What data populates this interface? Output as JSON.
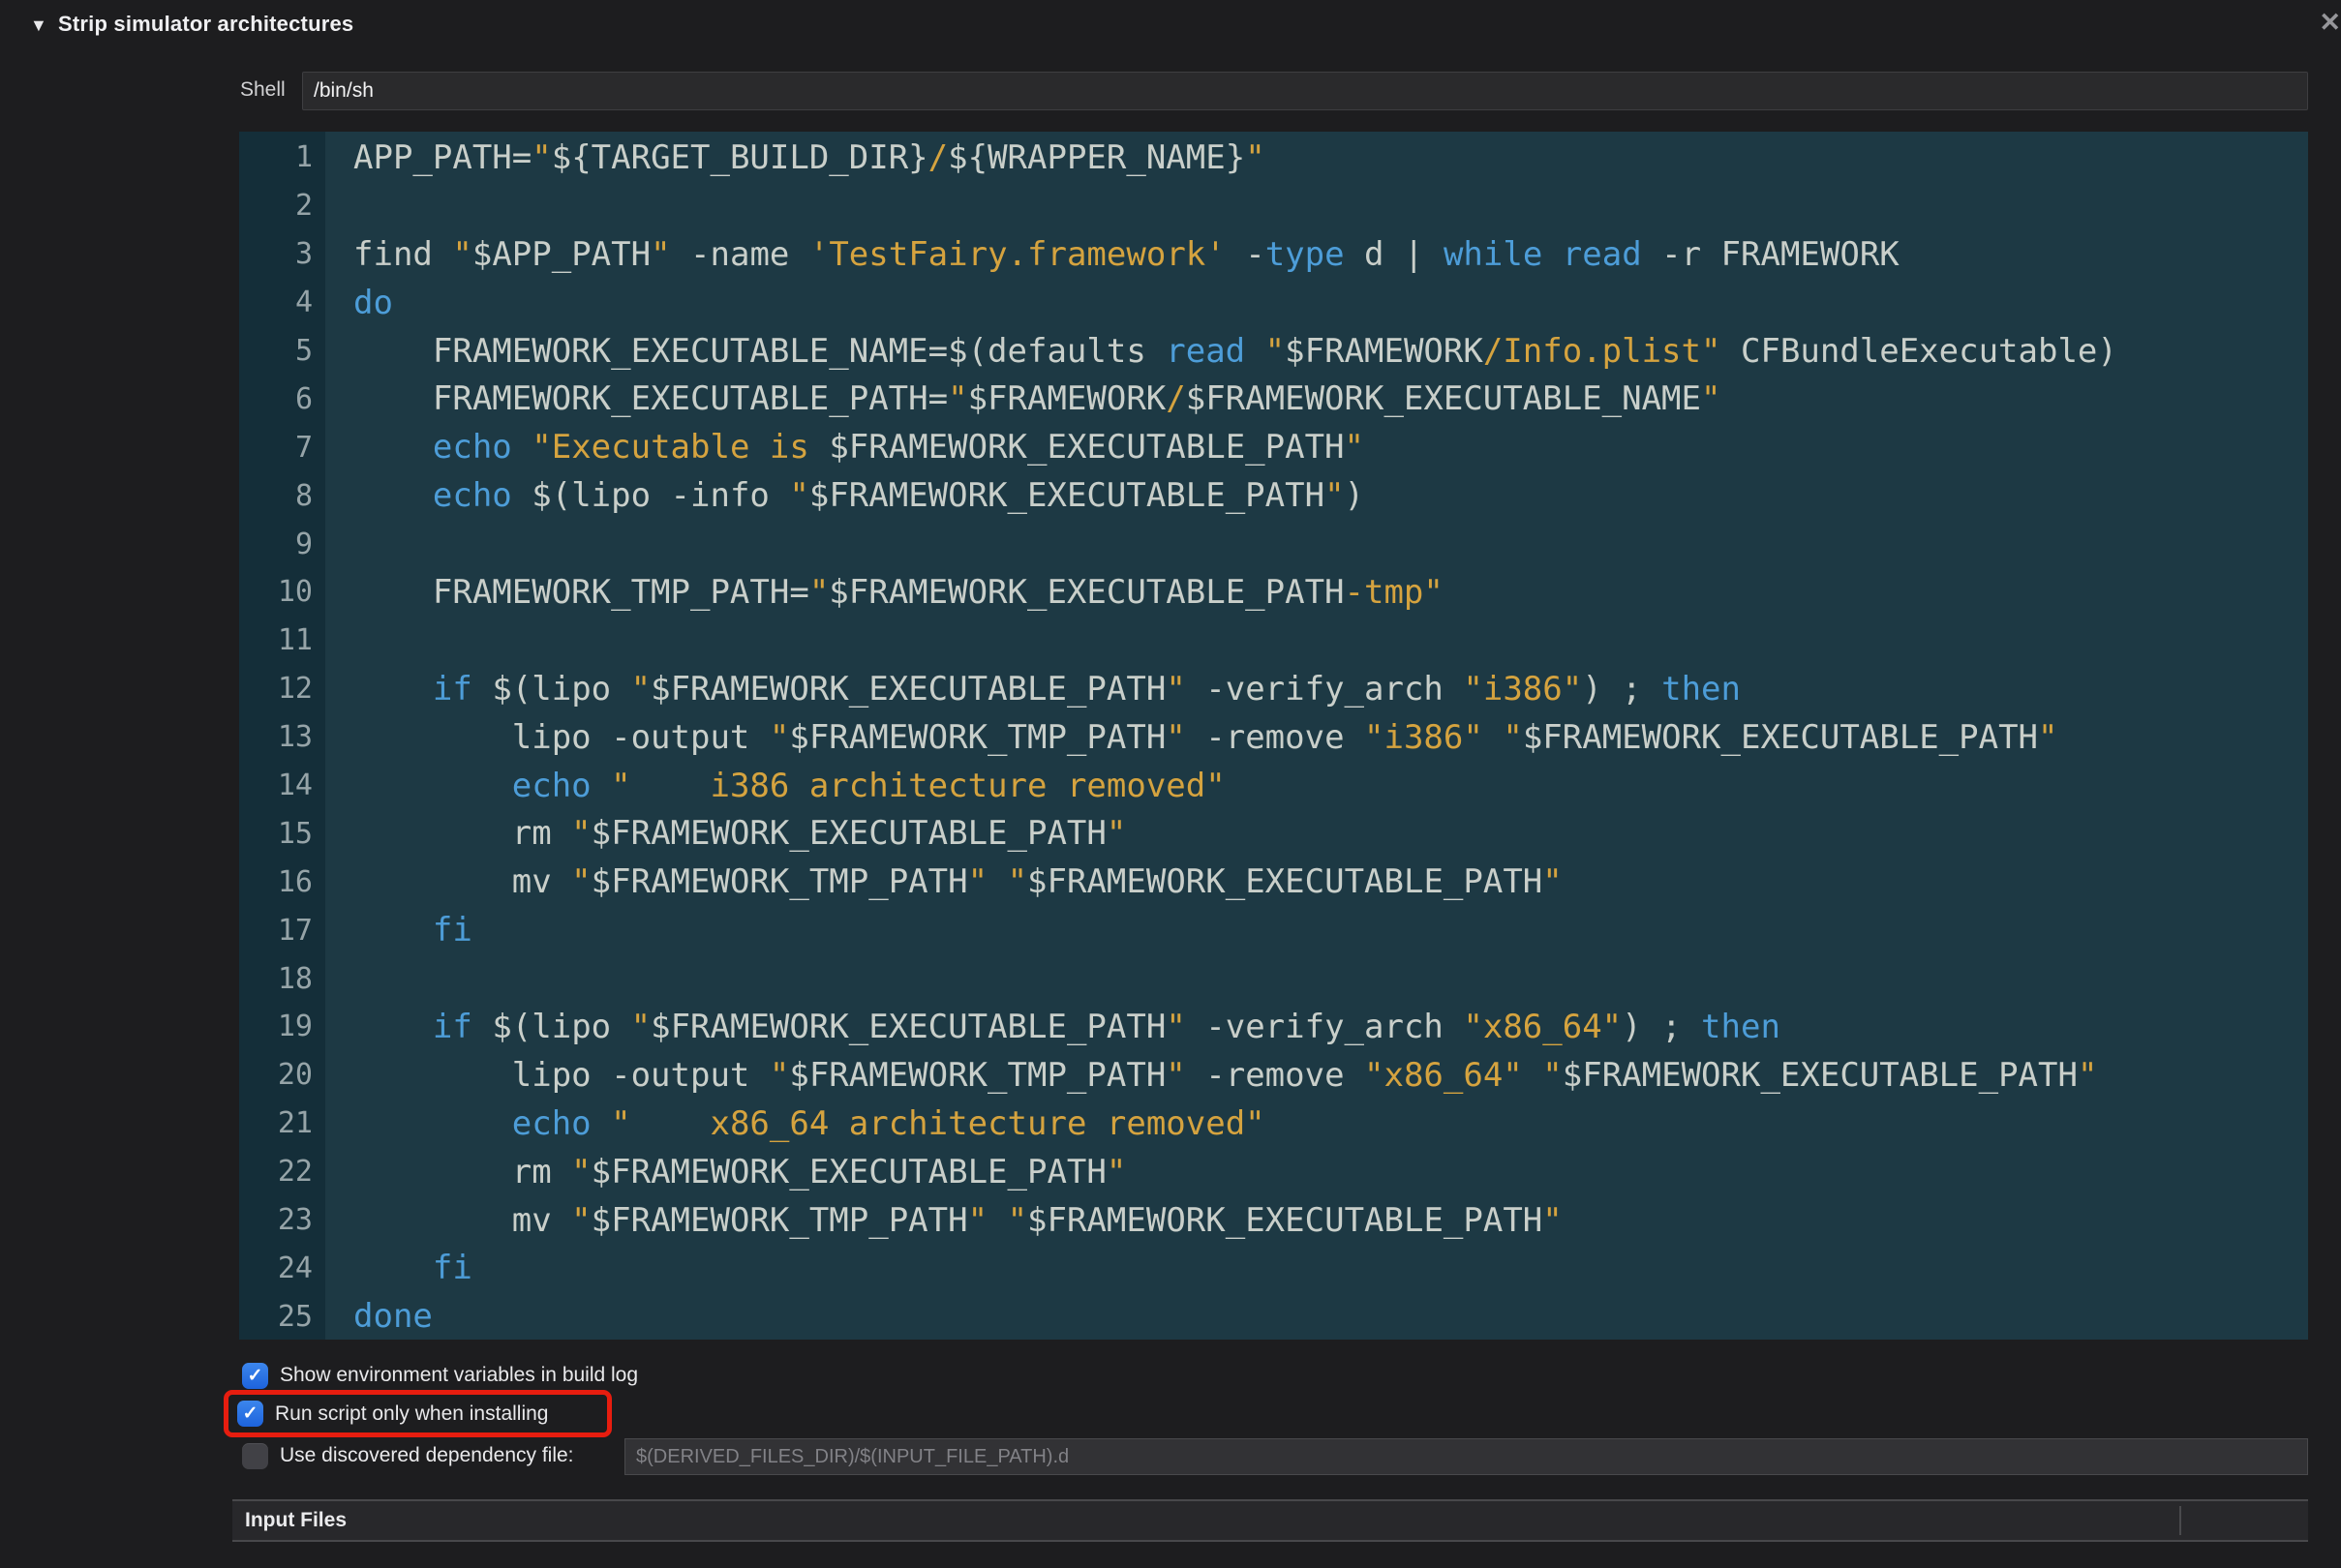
{
  "header": {
    "title": "Strip simulator architectures"
  },
  "icons": {
    "disclosure_glyph": "▼",
    "close_glyph": "✕",
    "check_glyph": "✓"
  },
  "shell": {
    "label": "Shell",
    "value": "/bin/sh"
  },
  "editor": {
    "lines": [
      {
        "n": 1,
        "tokens": [
          [
            "p",
            "APP_PATH="
          ],
          [
            "s",
            "\""
          ],
          [
            "p",
            "${TARGET_BUILD_DIR}"
          ],
          [
            "s",
            "/"
          ],
          [
            "p",
            "${WRAPPER_NAME}"
          ],
          [
            "s",
            "\""
          ]
        ]
      },
      {
        "n": 2,
        "tokens": []
      },
      {
        "n": 3,
        "tokens": [
          [
            "p",
            "find "
          ],
          [
            "s",
            "\""
          ],
          [
            "p",
            "$APP_PATH"
          ],
          [
            "s",
            "\""
          ],
          [
            "p",
            " -name "
          ],
          [
            "s",
            "'TestFairy.framework'"
          ],
          [
            "p",
            " -"
          ],
          [
            "k",
            "type"
          ],
          [
            "p",
            " d | "
          ],
          [
            "k",
            "while"
          ],
          [
            "p",
            " "
          ],
          [
            "k",
            "read"
          ],
          [
            "p",
            " -r FRAMEWORK"
          ]
        ]
      },
      {
        "n": 4,
        "tokens": [
          [
            "k",
            "do"
          ]
        ]
      },
      {
        "n": 5,
        "tokens": [
          [
            "p",
            "    FRAMEWORK_EXECUTABLE_NAME=$(defaults "
          ],
          [
            "k",
            "read"
          ],
          [
            "p",
            " "
          ],
          [
            "s",
            "\""
          ],
          [
            "p",
            "$FRAMEWORK"
          ],
          [
            "s",
            "/Info.plist\""
          ],
          [
            "p",
            " CFBundleExecutable)"
          ]
        ]
      },
      {
        "n": 6,
        "tokens": [
          [
            "p",
            "    FRAMEWORK_EXECUTABLE_PATH="
          ],
          [
            "s",
            "\""
          ],
          [
            "p",
            "$FRAMEWORK"
          ],
          [
            "s",
            "/"
          ],
          [
            "p",
            "$FRAMEWORK_EXECUTABLE_NAME"
          ],
          [
            "s",
            "\""
          ]
        ]
      },
      {
        "n": 7,
        "tokens": [
          [
            "p",
            "    "
          ],
          [
            "k",
            "echo"
          ],
          [
            "p",
            " "
          ],
          [
            "s",
            "\"Executable is "
          ],
          [
            "p",
            "$FRAMEWORK_EXECUTABLE_PATH"
          ],
          [
            "s",
            "\""
          ]
        ]
      },
      {
        "n": 8,
        "tokens": [
          [
            "p",
            "    "
          ],
          [
            "k",
            "echo"
          ],
          [
            "p",
            " $(lipo -info "
          ],
          [
            "s",
            "\""
          ],
          [
            "p",
            "$FRAMEWORK_EXECUTABLE_PATH"
          ],
          [
            "s",
            "\""
          ],
          [
            "p",
            ")"
          ]
        ]
      },
      {
        "n": 9,
        "tokens": []
      },
      {
        "n": 10,
        "tokens": [
          [
            "p",
            "    FRAMEWORK_TMP_PATH="
          ],
          [
            "s",
            "\""
          ],
          [
            "p",
            "$FRAMEWORK_EXECUTABLE_PATH"
          ],
          [
            "s",
            "-tmp\""
          ]
        ]
      },
      {
        "n": 11,
        "tokens": []
      },
      {
        "n": 12,
        "tokens": [
          [
            "p",
            "    "
          ],
          [
            "k",
            "if"
          ],
          [
            "p",
            " $(lipo "
          ],
          [
            "s",
            "\""
          ],
          [
            "p",
            "$FRAMEWORK_EXECUTABLE_PATH"
          ],
          [
            "s",
            "\""
          ],
          [
            "p",
            " -verify_arch "
          ],
          [
            "s",
            "\"i386\""
          ],
          [
            "p",
            ") ; "
          ],
          [
            "k",
            "then"
          ]
        ]
      },
      {
        "n": 13,
        "tokens": [
          [
            "p",
            "        lipo -output "
          ],
          [
            "s",
            "\""
          ],
          [
            "p",
            "$FRAMEWORK_TMP_PATH"
          ],
          [
            "s",
            "\""
          ],
          [
            "p",
            " -remove "
          ],
          [
            "s",
            "\"i386\""
          ],
          [
            "p",
            " "
          ],
          [
            "s",
            "\""
          ],
          [
            "p",
            "$FRAMEWORK_EXECUTABLE_PATH"
          ],
          [
            "s",
            "\""
          ]
        ]
      },
      {
        "n": 14,
        "tokens": [
          [
            "p",
            "        "
          ],
          [
            "k",
            "echo"
          ],
          [
            "p",
            " "
          ],
          [
            "s",
            "\"    i386 architecture removed\""
          ]
        ]
      },
      {
        "n": 15,
        "tokens": [
          [
            "p",
            "        rm "
          ],
          [
            "s",
            "\""
          ],
          [
            "p",
            "$FRAMEWORK_EXECUTABLE_PATH"
          ],
          [
            "s",
            "\""
          ]
        ]
      },
      {
        "n": 16,
        "tokens": [
          [
            "p",
            "        mv "
          ],
          [
            "s",
            "\""
          ],
          [
            "p",
            "$FRAMEWORK_TMP_PATH"
          ],
          [
            "s",
            "\""
          ],
          [
            "p",
            " "
          ],
          [
            "s",
            "\""
          ],
          [
            "p",
            "$FRAMEWORK_EXECUTABLE_PATH"
          ],
          [
            "s",
            "\""
          ]
        ]
      },
      {
        "n": 17,
        "tokens": [
          [
            "p",
            "    "
          ],
          [
            "k",
            "fi"
          ]
        ]
      },
      {
        "n": 18,
        "tokens": []
      },
      {
        "n": 19,
        "tokens": [
          [
            "p",
            "    "
          ],
          [
            "k",
            "if"
          ],
          [
            "p",
            " $(lipo "
          ],
          [
            "s",
            "\""
          ],
          [
            "p",
            "$FRAMEWORK_EXECUTABLE_PATH"
          ],
          [
            "s",
            "\""
          ],
          [
            "p",
            " -verify_arch "
          ],
          [
            "s",
            "\"x86_64\""
          ],
          [
            "p",
            ") ; "
          ],
          [
            "k",
            "then"
          ]
        ]
      },
      {
        "n": 20,
        "tokens": [
          [
            "p",
            "        lipo -output "
          ],
          [
            "s",
            "\""
          ],
          [
            "p",
            "$FRAMEWORK_TMP_PATH"
          ],
          [
            "s",
            "\""
          ],
          [
            "p",
            " -remove "
          ],
          [
            "s",
            "\"x86_64\""
          ],
          [
            "p",
            " "
          ],
          [
            "s",
            "\""
          ],
          [
            "p",
            "$FRAMEWORK_EXECUTABLE_PATH"
          ],
          [
            "s",
            "\""
          ]
        ]
      },
      {
        "n": 21,
        "tokens": [
          [
            "p",
            "        "
          ],
          [
            "k",
            "echo"
          ],
          [
            "p",
            " "
          ],
          [
            "s",
            "\"    x86_64 architecture removed\""
          ]
        ]
      },
      {
        "n": 22,
        "tokens": [
          [
            "p",
            "        rm "
          ],
          [
            "s",
            "\""
          ],
          [
            "p",
            "$FRAMEWORK_EXECUTABLE_PATH"
          ],
          [
            "s",
            "\""
          ]
        ]
      },
      {
        "n": 23,
        "tokens": [
          [
            "p",
            "        mv "
          ],
          [
            "s",
            "\""
          ],
          [
            "p",
            "$FRAMEWORK_TMP_PATH"
          ],
          [
            "s",
            "\""
          ],
          [
            "p",
            " "
          ],
          [
            "s",
            "\""
          ],
          [
            "p",
            "$FRAMEWORK_EXECUTABLE_PATH"
          ],
          [
            "s",
            "\""
          ]
        ]
      },
      {
        "n": 24,
        "tokens": [
          [
            "p",
            "    "
          ],
          [
            "k",
            "fi"
          ]
        ]
      },
      {
        "n": 25,
        "tokens": [
          [
            "k",
            "done"
          ]
        ]
      }
    ]
  },
  "options": {
    "checkboxes": [
      {
        "label": "Show environment variables in build log",
        "checked": true,
        "highlighted": false
      },
      {
        "label": "Run script only when installing",
        "checked": true,
        "highlighted": true
      },
      {
        "label": "Use discovered dependency file:",
        "checked": false,
        "highlighted": false,
        "field_placeholder": "$(DERIVED_FILES_DIR)/$(INPUT_FILE_PATH).d"
      }
    ]
  },
  "input_files": {
    "label": "Input Files"
  },
  "colors": {
    "page_background": "#1d1d1f",
    "editor_background": "#1d3944",
    "gutter_background": "#142e39",
    "code_plain": "#c9cfca",
    "code_string": "#d5a33f",
    "code_keyword": "#4d9dd8",
    "line_number": "#96a4a8",
    "checkbox_accent_blue": "#2273df",
    "annotation_red": "#e71d0f"
  }
}
